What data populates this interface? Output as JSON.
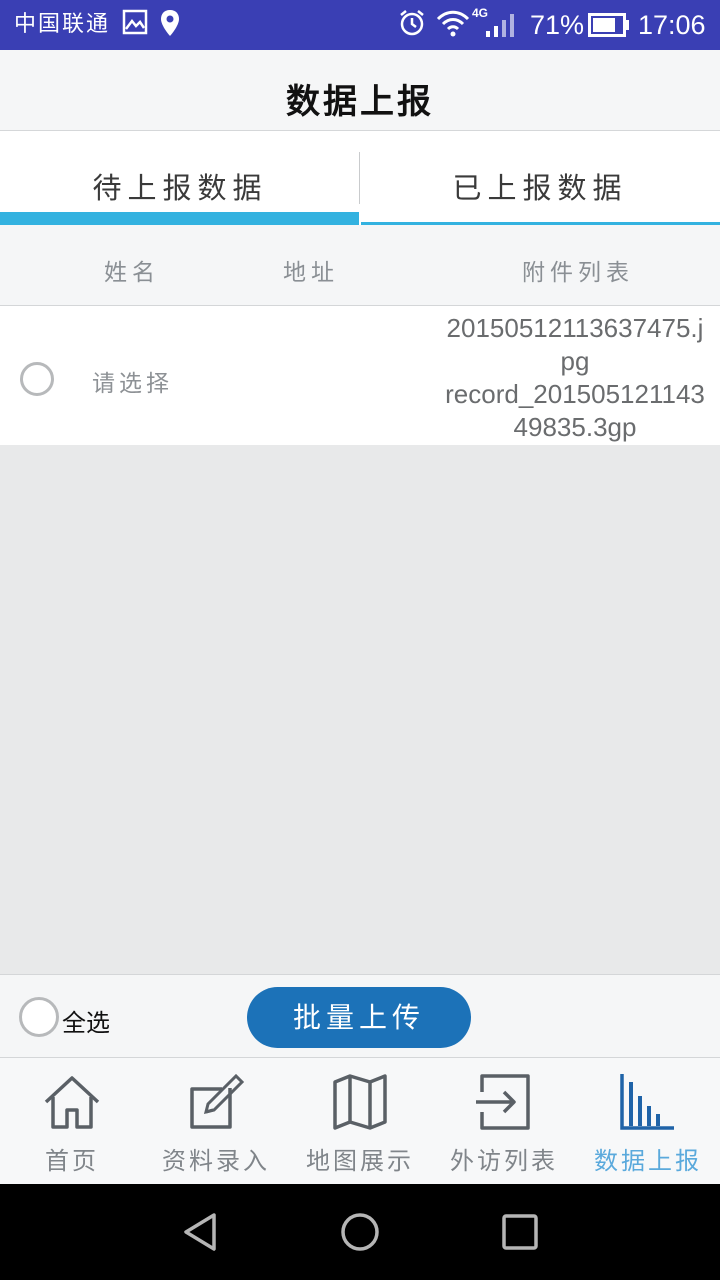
{
  "status_bar": {
    "carrier": "中国联通",
    "network": "4G",
    "battery": "71%",
    "time": "17:06"
  },
  "title": "数据上报",
  "tabs": [
    {
      "label": "待上报数据",
      "active": true
    },
    {
      "label": "已上报数据",
      "active": false
    }
  ],
  "table": {
    "headers": [
      "姓名",
      "地址",
      "附件列表"
    ],
    "rows": [
      {
        "name_placeholder": "请选择",
        "attachments_line1": "20150512113637475.j",
        "attachments_line2": "pg",
        "attachments_line3": "record_201505121143",
        "attachments_line4": "49835.3gp"
      }
    ]
  },
  "actions": {
    "select_all": "全选",
    "batch_upload": "批量上传"
  },
  "bottom_nav": [
    {
      "label": "首页",
      "icon": "home-icon"
    },
    {
      "label": "资料录入",
      "icon": "edit-icon"
    },
    {
      "label": "地图展示",
      "icon": "map-icon"
    },
    {
      "label": "外访列表",
      "icon": "exit-icon"
    },
    {
      "label": "数据上报",
      "icon": "bar-chart-icon",
      "active": true
    }
  ],
  "colors": {
    "status_bar": "#3a3fb4",
    "accent": "#33b2e0",
    "button": "#1c72b8",
    "nav_active": "#5aa9dc"
  }
}
